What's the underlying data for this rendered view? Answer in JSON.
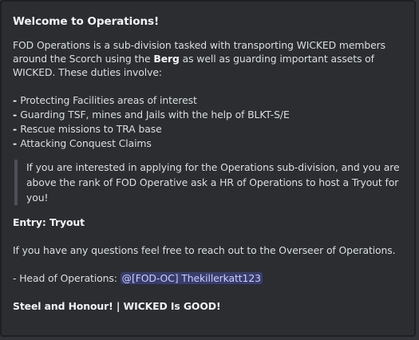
{
  "embed": {
    "title": "Welcome to Operations!",
    "intro_before_bold": "FOD Operations is a sub-division tasked with transporting WICKED members around the Scorch using the ",
    "intro_bold": "Berg",
    "intro_after_bold": " as well as guarding important assets of WICKED. These duties involve:",
    "duties": [
      "Protecting Facilities areas of interest",
      "Guarding TSF, mines and Jails with the help of BLKT-S/E",
      "Rescue missions to TRA base",
      "Attacking Conquest Claims"
    ],
    "bullet": "- ",
    "quote": "If you are interested in applying for the Operations sub-division, and you are above the rank of FOD Operative ask a HR of Operations to host a Tryout for you!",
    "entry": "Entry: Tryout",
    "questions": "If you have any questions feel free to reach out to the Overseer of Operations.",
    "head_label": "- Head of Operations: ",
    "head_mention": "@[FOD-OC] Thekillerkatt123",
    "closing": "Steel and Honour! | WICKED Is GOOD!"
  }
}
